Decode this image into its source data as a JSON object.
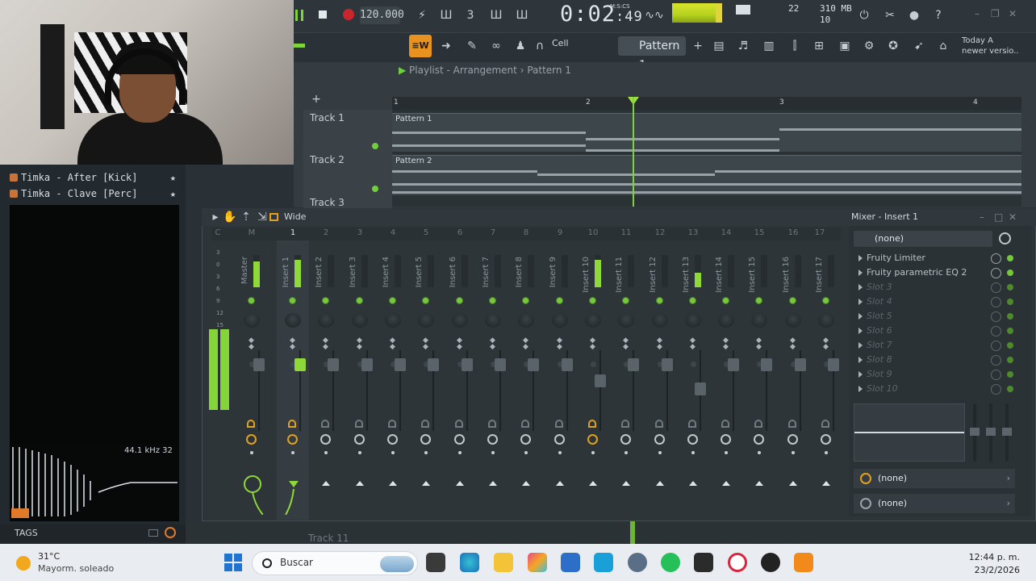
{
  "transport": {
    "tempo": "120.000",
    "time_main": "0:02",
    "time_sub": ":49",
    "time_unit": "M:S:CS",
    "poly_count": "22",
    "mem": "310 MB",
    "cpu_count": "10"
  },
  "toolbar": {
    "snap_label": "Cell",
    "pattern_label": "Pattern 1",
    "news_line1": "Today  A",
    "news_line2": "newer versio.."
  },
  "browser": {
    "items": [
      {
        "label": "Timka - After [Kick]"
      },
      {
        "label": "Timka - Clave [Perc]"
      }
    ],
    "sample_rate": "44.1 kHz 32",
    "tags_label": "TAGS"
  },
  "playlist": {
    "breadcrumb": "Playlist - Arrangement",
    "current_pattern": "Pattern 1",
    "ruler": [
      "1",
      "2",
      "3",
      "4"
    ],
    "tracks": [
      {
        "label": "Track 1",
        "clip": "Pattern 1"
      },
      {
        "label": "Track 2",
        "clip": "Pattern 2"
      },
      {
        "label": "Track 3"
      }
    ],
    "bottom_track": "Track 11"
  },
  "mixer": {
    "view": "Wide",
    "title": "Mixer - Insert 1",
    "header_nums": [
      "C",
      "M",
      "1",
      "2",
      "3",
      "4",
      "5",
      "6",
      "7",
      "8",
      "9",
      "10",
      "11",
      "12",
      "13",
      "14",
      "15",
      "16",
      "17"
    ],
    "strips": [
      {
        "name": "Master",
        "level": 0.8
      },
      {
        "name": "Insert 1",
        "level": 0.85
      },
      {
        "name": "Insert 2",
        "level": 0
      },
      {
        "name": "Insert 3",
        "level": 0
      },
      {
        "name": "Insert 4",
        "level": 0
      },
      {
        "name": "Insert 5",
        "level": 0
      },
      {
        "name": "Insert 6",
        "level": 0
      },
      {
        "name": "Insert 7",
        "level": 0
      },
      {
        "name": "Insert 8",
        "level": 0
      },
      {
        "name": "Insert 9",
        "level": 0
      },
      {
        "name": "Insert 10",
        "level": 0.85
      },
      {
        "name": "Insert 11",
        "level": 0
      },
      {
        "name": "Insert 12",
        "level": 0
      },
      {
        "name": "Insert 13",
        "level": 0.45
      },
      {
        "name": "Insert 14",
        "level": 0
      },
      {
        "name": "Insert 15",
        "level": 0
      },
      {
        "name": "Insert 16",
        "level": 0
      },
      {
        "name": "Insert 17",
        "level": 0
      }
    ],
    "master_scale": [
      "3",
      "0",
      "3",
      "6",
      "9",
      "12",
      "15"
    ],
    "preset": "(none)",
    "slots": [
      {
        "label": "Fruity Limiter",
        "empty": false
      },
      {
        "label": "Fruity parametric EQ 2",
        "empty": false
      },
      {
        "label": "Slot 3",
        "empty": true
      },
      {
        "label": "Slot 4",
        "empty": true
      },
      {
        "label": "Slot 5",
        "empty": true
      },
      {
        "label": "Slot 6",
        "empty": true
      },
      {
        "label": "Slot 7",
        "empty": true
      },
      {
        "label": "Slot 8",
        "empty": true
      },
      {
        "label": "Slot 9",
        "empty": true
      },
      {
        "label": "Slot 10",
        "empty": true
      }
    ],
    "input_route": "(none)",
    "output_route": "(none)"
  },
  "taskbar": {
    "temp": "31°C",
    "weather": "Mayorm. soleado",
    "search": "Buscar",
    "time": "12:44 p. m.",
    "date": "23/2/2026"
  },
  "colors": {
    "accent_green": "#7ed43b",
    "rec_red": "#c8262b",
    "orange": "#e0a020"
  }
}
